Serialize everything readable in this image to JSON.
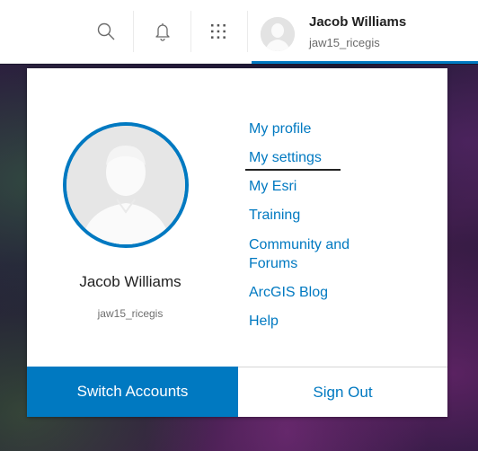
{
  "header": {
    "user_name": "Jacob Williams",
    "username": "jaw15_ricegis",
    "icons": [
      "search-icon",
      "bell-icon",
      "app-launcher-icon"
    ]
  },
  "profile": {
    "name": "Jacob Williams",
    "username": "jaw15_ricegis"
  },
  "menu": {
    "items": [
      {
        "label": "My profile"
      },
      {
        "label": "My settings"
      },
      {
        "label": "My Esri"
      },
      {
        "label": "Training"
      },
      {
        "label": "Community and Forums"
      },
      {
        "label": "ArcGIS Blog"
      },
      {
        "label": "Help"
      }
    ]
  },
  "buttons": {
    "switch_accounts": "Switch Accounts",
    "sign_out": "Sign Out"
  },
  "colors": {
    "accent": "#0079c1",
    "avatar_bg": "#e6e6e6"
  }
}
